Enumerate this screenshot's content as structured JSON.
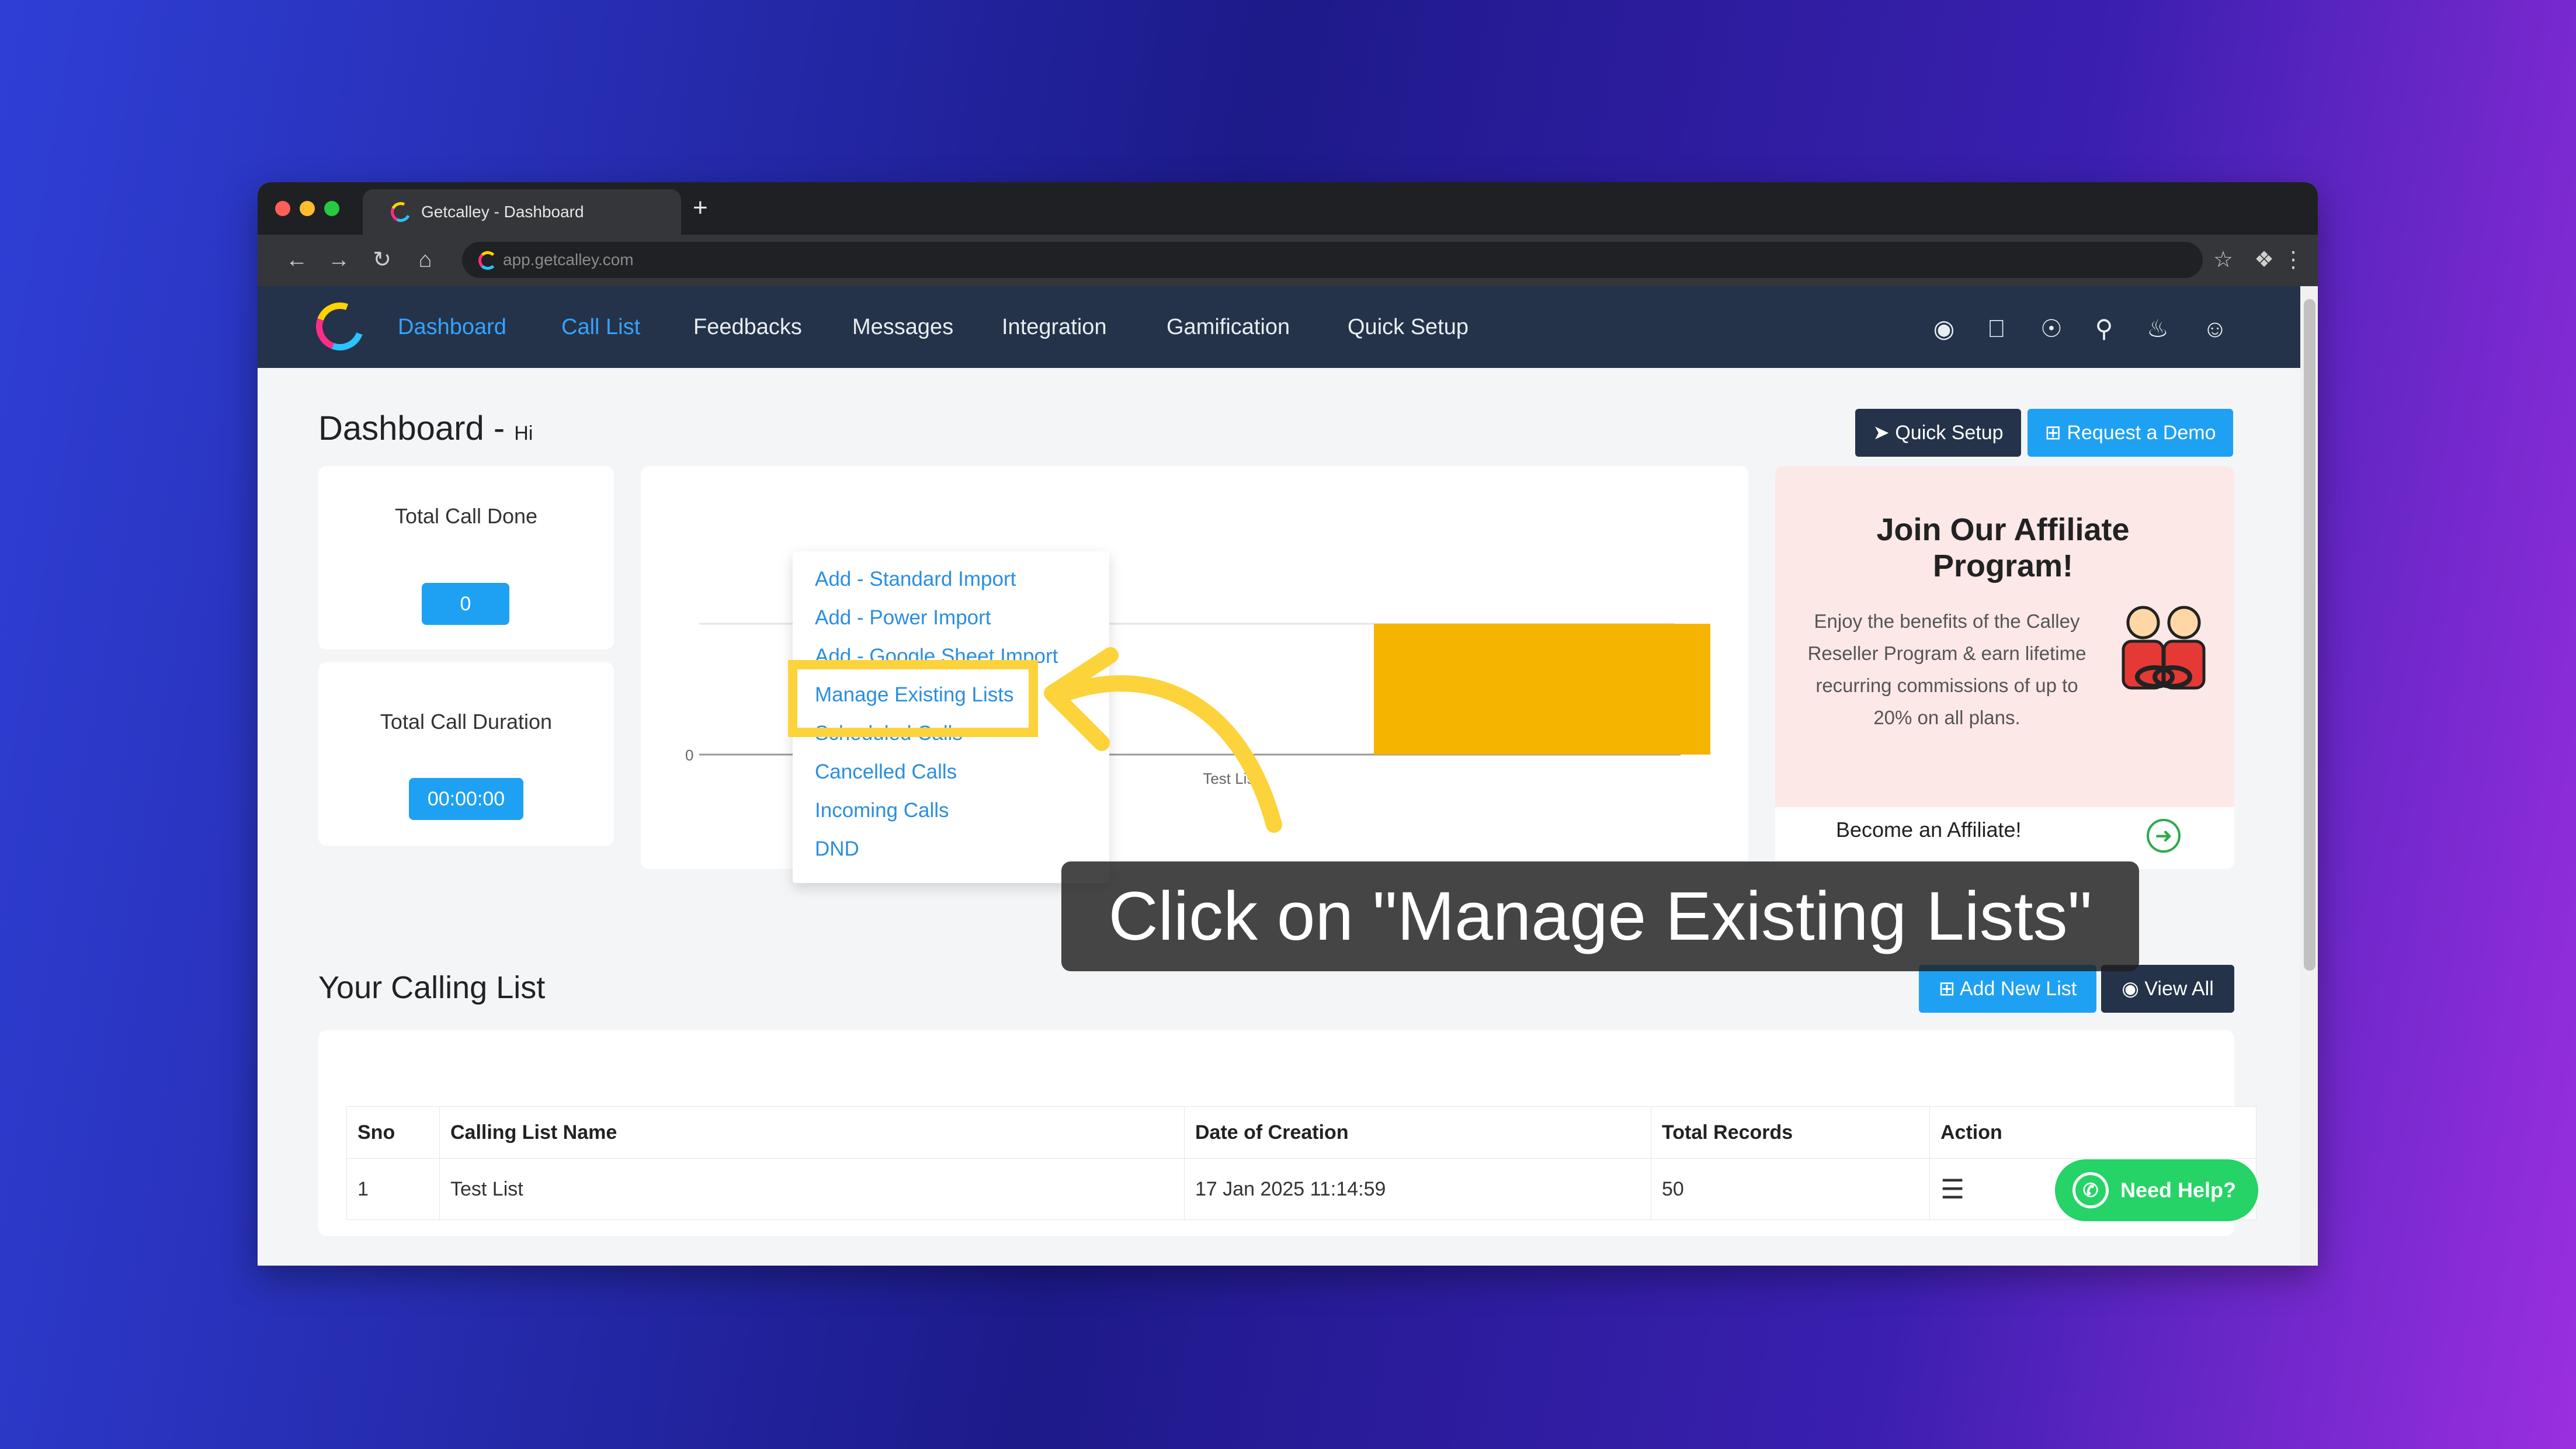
{
  "browser": {
    "tab_title": "Getcalley - Dashboard",
    "new_tab": "+",
    "url": "app.getcalley.com"
  },
  "nav": {
    "items": [
      "Dashboard",
      "Call List",
      "Feedbacks",
      "Messages",
      "Integration",
      "Gamification",
      "Quick Setup"
    ],
    "active": "Dashboard",
    "open_menu": "Call List"
  },
  "dropdown": {
    "items": [
      "Add - Standard Import",
      "Add - Power Import",
      "Add - Google Sheet Import",
      "Manage Existing Lists",
      "Scheduled Calls",
      "Cancelled Calls",
      "Incoming Calls",
      "DND"
    ],
    "highlighted": "Manage Existing Lists"
  },
  "dashboard": {
    "title": "Dashboard -",
    "greeting": "Hi",
    "quick_setup_button": "Quick Setup",
    "request_demo_button": "Request a Demo"
  },
  "stats": {
    "total_call_done_label": "Total Call Done",
    "total_call_done_value": "0",
    "total_call_duration_label": "Total Call Duration",
    "total_call_duration_value": "00:00:00"
  },
  "chart_data": {
    "type": "bar",
    "categories": [
      "Test List"
    ],
    "values": [
      50
    ],
    "ytick_zero": "0",
    "color": "#f4b400"
  },
  "affiliate": {
    "title": "Join Our Affiliate Program!",
    "body": "Enjoy the benefits of the Calley Reseller Program & earn lifetime recurring commissions of up to 20% on all plans.",
    "link": "Become an Affiliate!"
  },
  "calling_list": {
    "heading": "Your Calling List",
    "add_button": "Add New List",
    "view_all_button": "View All",
    "columns": [
      "Sno",
      "Calling List Name",
      "Date of Creation",
      "Total Records",
      "Action"
    ],
    "rows": [
      {
        "sno": "1",
        "name": "Test List",
        "date": "17 Jan 2025 11:14:59",
        "records": "50"
      }
    ]
  },
  "caption": "Click on \"Manage Existing Lists\"",
  "help_button": "Need Help?",
  "colors": {
    "nav_bg": "#243349",
    "accent_blue": "#1ea1f2",
    "highlight_yellow": "#fdd33b",
    "whatsapp_green": "#25d366"
  }
}
